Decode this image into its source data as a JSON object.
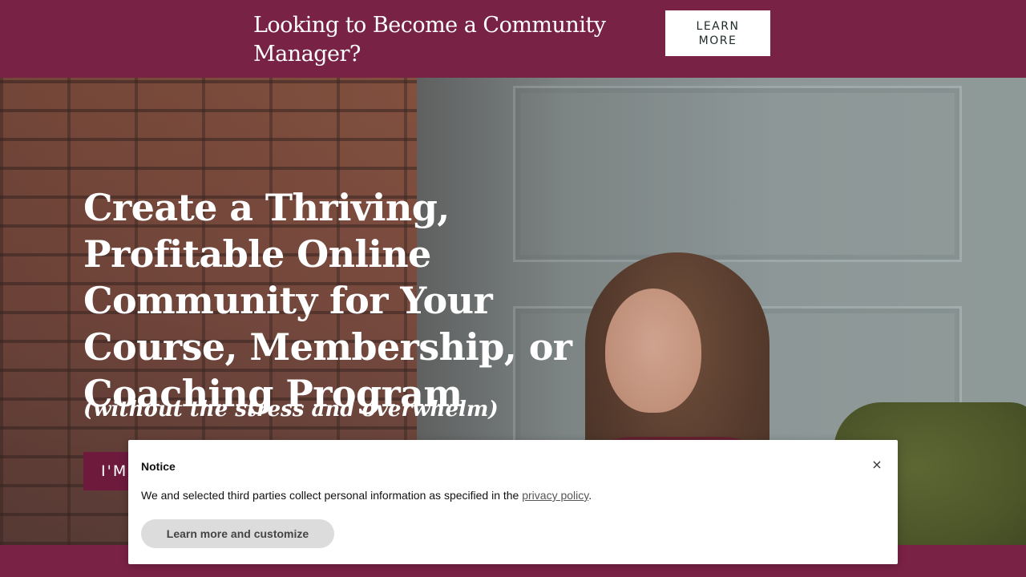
{
  "banner": {
    "text": "Looking to Become a Community Manager?",
    "button_label": "LEARN MORE"
  },
  "hero": {
    "title": "Create a Thriving, Profitable Online Community for Your Course, Membership, or Coaching Program",
    "subtitle": "(without the stress and overwhelm)",
    "cta_label": "I'M"
  },
  "notice": {
    "title": "Notice",
    "close_label": "×",
    "text_before": "We and selected third parties collect personal information as specified in the ",
    "link_label": "privacy policy",
    "text_after": ".",
    "button_label": "Learn more and customize"
  },
  "colors": {
    "brand": "#782346",
    "cta": "#6e1a3d"
  }
}
